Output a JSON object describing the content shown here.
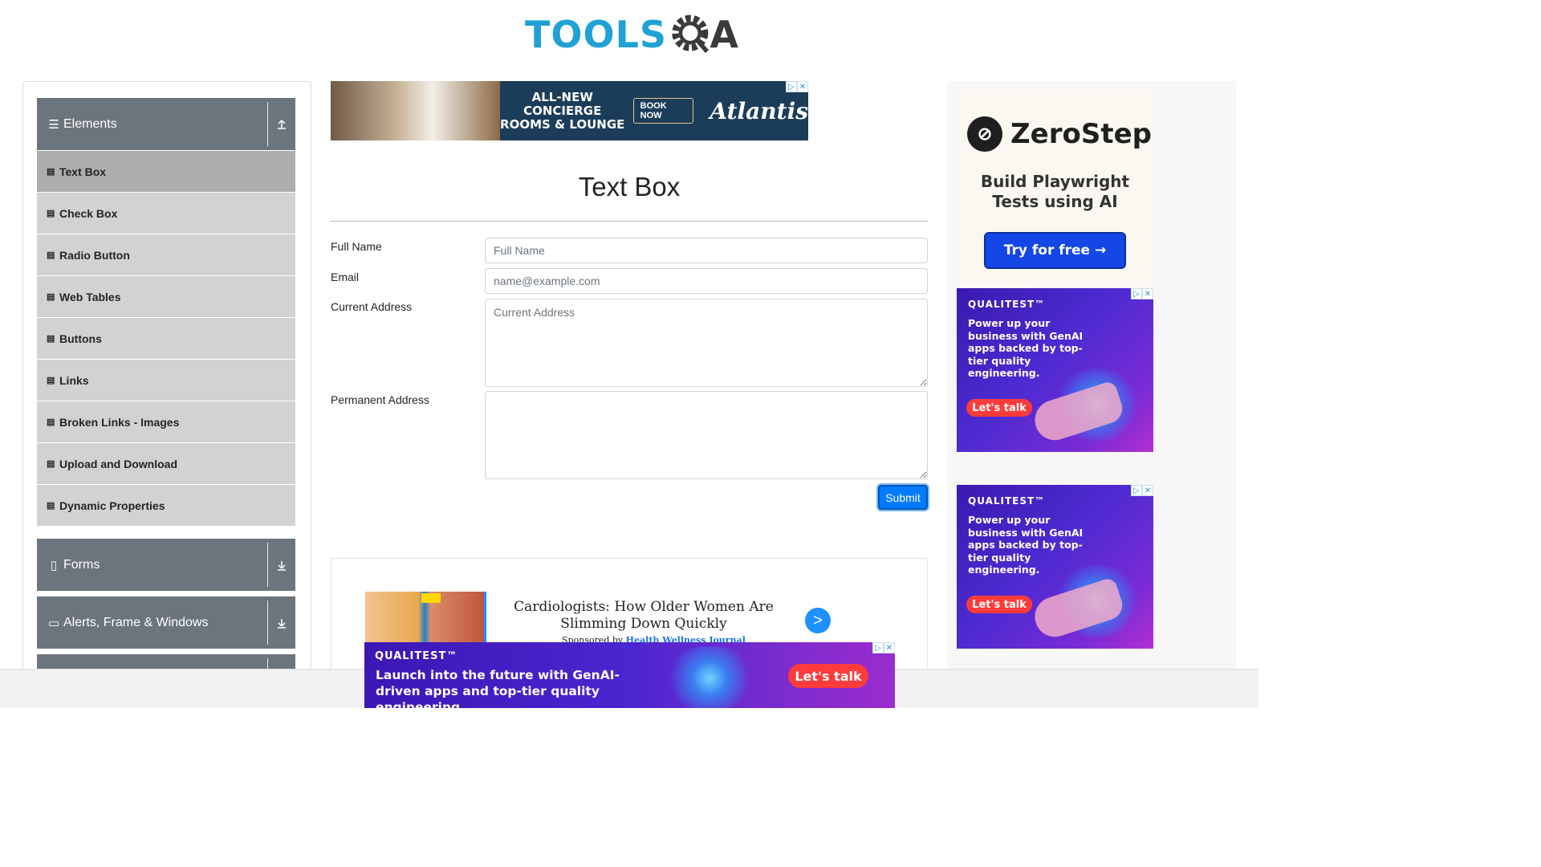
{
  "logo": {
    "left": "TOOLS",
    "right": "A"
  },
  "sidebar": {
    "groups": [
      {
        "label": "Elements",
        "icon": "hamburger-icon",
        "arrow": "collapse-up-icon"
      },
      {
        "label": "Forms",
        "icon": "document-icon",
        "arrow": "expand-down-icon"
      },
      {
        "label": "Alerts, Frame & Windows",
        "icon": "window-icon",
        "arrow": "expand-down-icon"
      }
    ],
    "items": [
      {
        "label": "Text Box",
        "active": true
      },
      {
        "label": "Check Box"
      },
      {
        "label": "Radio Button"
      },
      {
        "label": "Web Tables"
      },
      {
        "label": "Buttons"
      },
      {
        "label": "Links"
      },
      {
        "label": "Broken Links - Images"
      },
      {
        "label": "Upload and Download"
      },
      {
        "label": "Dynamic Properties"
      }
    ]
  },
  "top_ad": {
    "headline": "ALL-NEW CONCIERGE ROOMS & LOUNGE",
    "button": "BOOK NOW",
    "brand": "Atlantis"
  },
  "main": {
    "title": "Text Box",
    "form": {
      "full_name_label": "Full Name",
      "full_name_placeholder": "Full Name",
      "email_label": "Email",
      "email_placeholder": "name@example.com",
      "current_address_label": "Current Address",
      "current_address_placeholder": "Current Address",
      "permanent_address_label": "Permanent Address",
      "submit": "Submit"
    }
  },
  "sponsored": {
    "title": "Cardiologists: How Older Women Are Slimming Down Quickly",
    "by_prefix": "Sponsored by",
    "by_source": "Health Wellness Journal",
    "go": ">"
  },
  "right_ads": {
    "zerostep": {
      "brand": "ZeroStep",
      "subtitle": "Build Playwright Tests using AI",
      "button": "Try for free →"
    },
    "qualitest": {
      "brand": "QUALITEST™",
      "copy": "Power up your business with GenAI apps backed by top-tier quality engineering.",
      "button": "Let's talk"
    }
  },
  "bottom_banner": {
    "brand": "QUALITEST™",
    "copy": "Launch into the future with GenAI-driven apps and top-tier quality engineering.",
    "button": "Let's talk"
  },
  "colors": {
    "accent": "#007bff",
    "sidebar_header": "#6c757d",
    "sidebar_item": "#d2d2d2",
    "logo_blue": "#1fa1d6"
  }
}
